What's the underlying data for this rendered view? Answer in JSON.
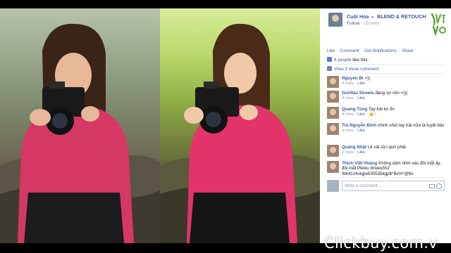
{
  "post": {
    "author": "Cuội Hoa",
    "arrow": "▸",
    "group": "BLEND & RETOUCH",
    "follow": "Follow",
    "time_separator": "·",
    "time": "10 mins",
    "logo_text": "Vật Vờ"
  },
  "actions": [
    "Like",
    "Comment",
    "Get Notifications",
    "Share"
  ],
  "likes": {
    "count_text": "8 people",
    "suffix": " like this."
  },
  "more_comments": "View 1 more comment",
  "comments": [
    {
      "name": "Nguyen Bi",
      "text": "=))",
      "meta_time": "4 mins",
      "meta_like": "Like",
      "meta_extra": ""
    },
    {
      "name": "Gorillas Streets",
      "text": "đáng sợ vồn =)))",
      "meta_time": "4 mins",
      "meta_like": "Like",
      "meta_extra": ""
    },
    {
      "name": "Quang Tùng",
      "text": "Tay trái ko ổn",
      "meta_time": "4 mins",
      "meta_like": "Like",
      "meta_extra": "1"
    },
    {
      "name": "Trà Nguyễn Đinh",
      "text": "chinh chút tay trái nữa là tuyệt bác",
      "meta_time": "3 mins",
      "meta_like": "Like",
      "meta_extra": ""
    },
    {
      "name": "Quang Nhật",
      "text": "Lê vải cả ỉ quờ phải",
      "meta_time": "2 mins",
      "meta_like": "Like",
      "meta_extra": ""
    },
    {
      "name": "Thích Việt Hoàng",
      "text": "Không dám nhìn vào đôi mắt ấy, đôi mắt Pleiku brweu5h2 9br4124vtgjw530535kgp$^$v%^@$v",
      "meta_time": "",
      "meta_like": "",
      "meta_extra": ""
    }
  ],
  "write_placeholder": "Write a comment...",
  "watermark": "Clickbuy.com.v",
  "colors": {
    "fb_blue": "#3b5998",
    "meta_gray": "#9197a3",
    "shirt_pink": "#e0386a"
  }
}
